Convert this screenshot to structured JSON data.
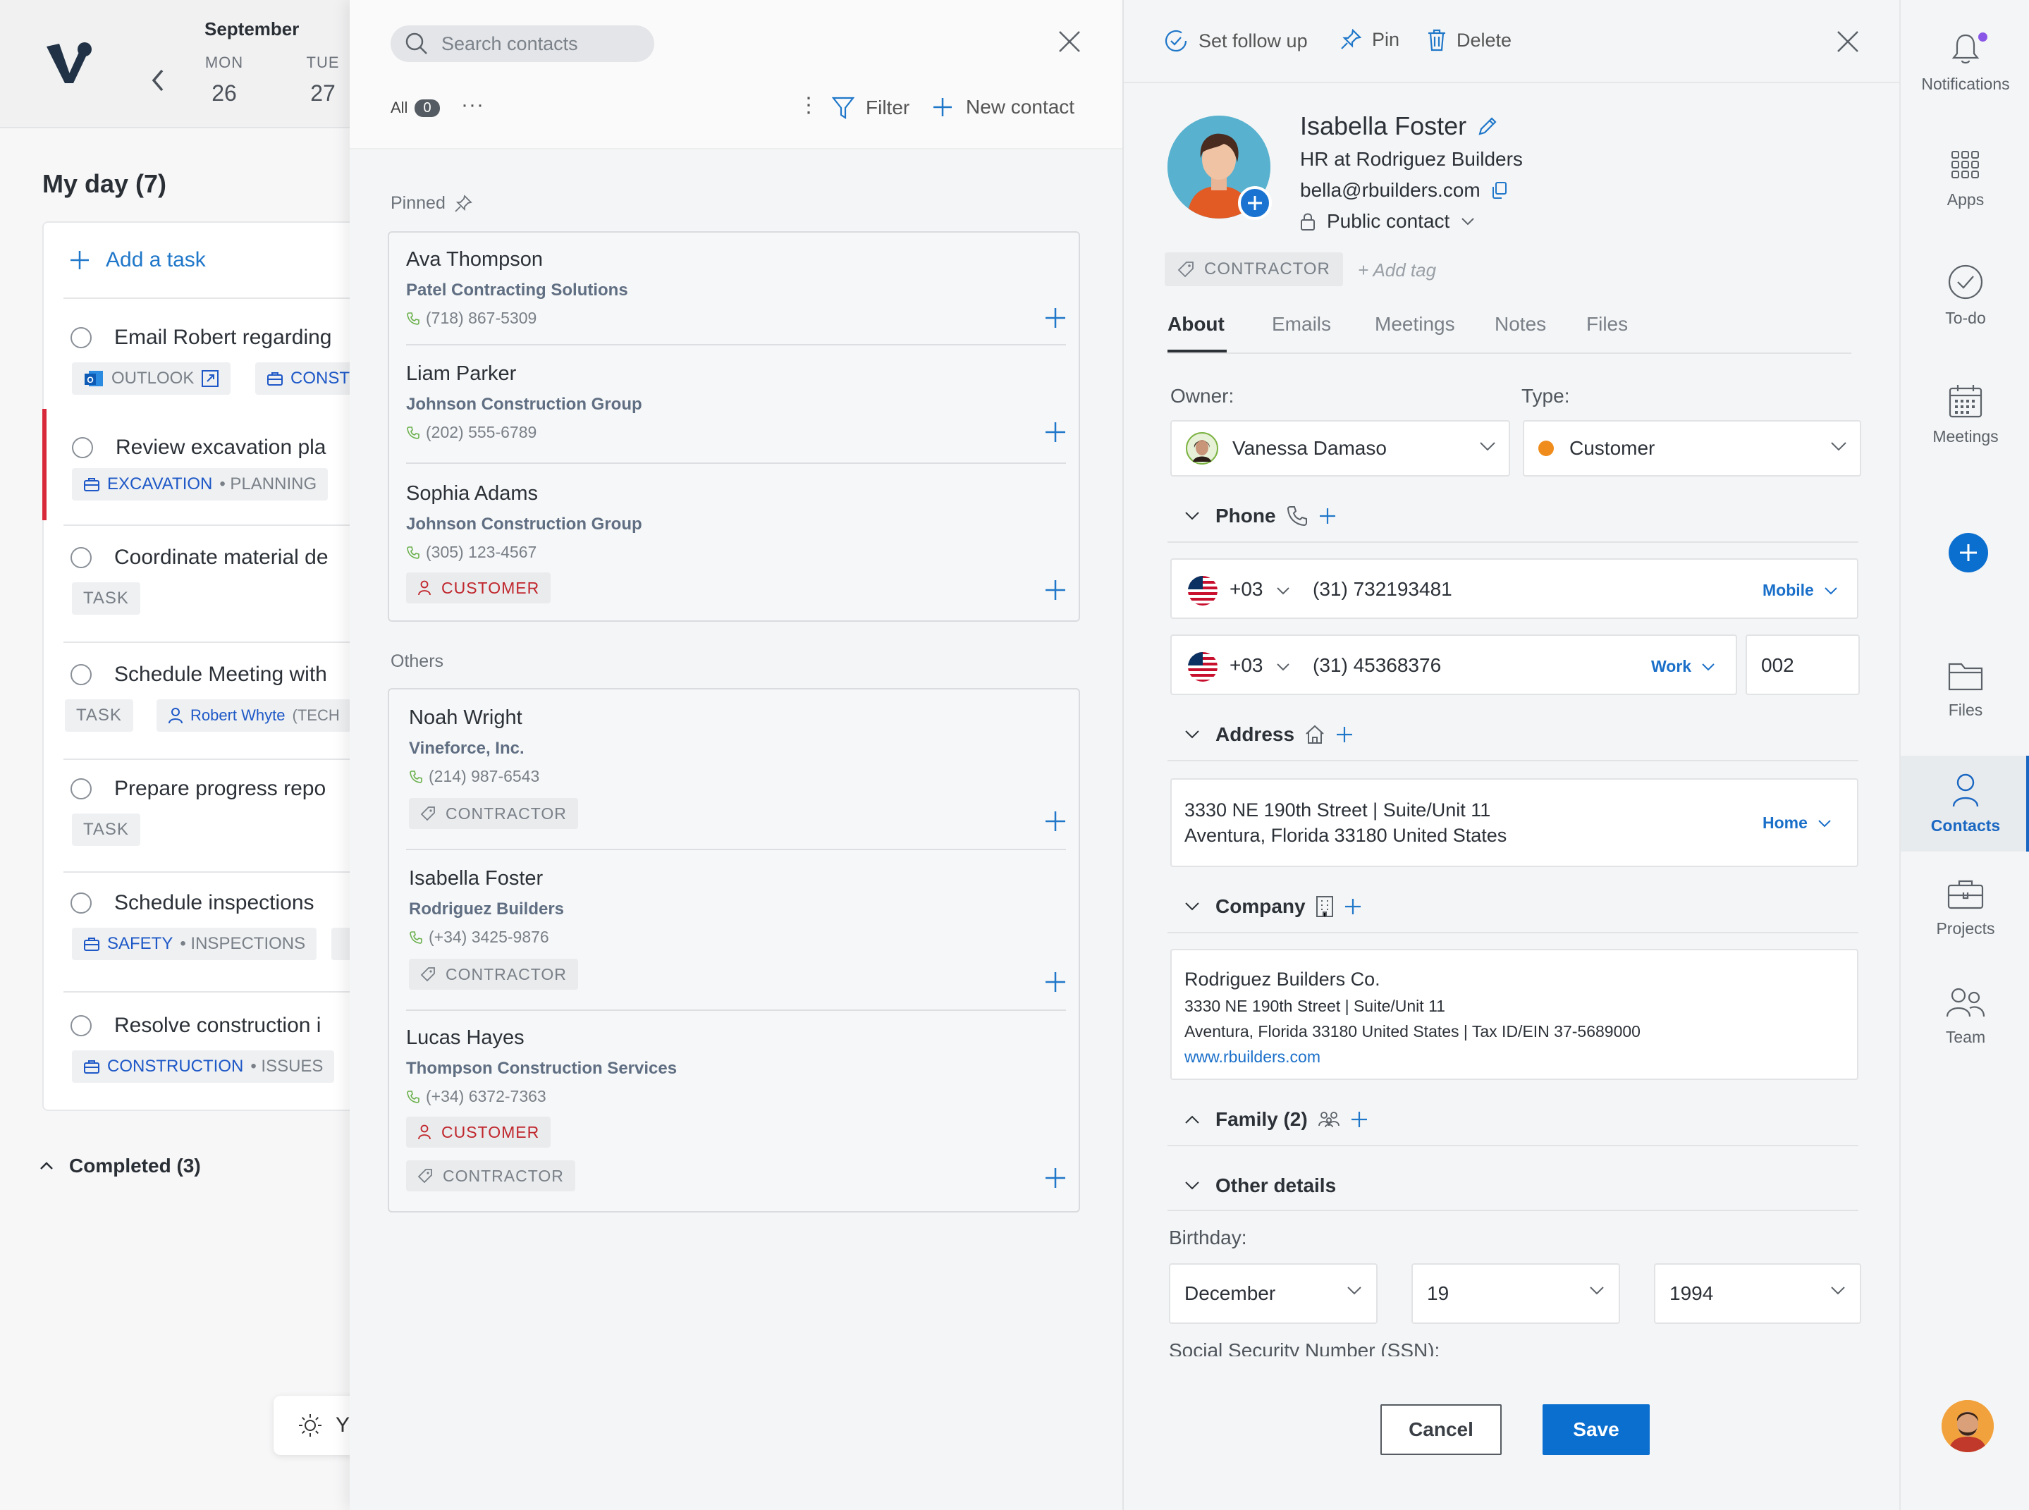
{
  "calendar": {
    "month": "September",
    "days": [
      {
        "name": "MON",
        "num": "26"
      },
      {
        "name": "TUE",
        "num": "27"
      }
    ]
  },
  "myday": {
    "title": "My day (7)",
    "add_task_label": "Add a task",
    "tasks": [
      {
        "title": "Email Robert regarding",
        "chip1_label": "OUTLOOK",
        "chip2_label": "CONST"
      },
      {
        "title": "Review excavation pla",
        "chip_main": "EXCAVATION",
        "chip_sub": "• PLANNING"
      },
      {
        "title": "Coordinate material de",
        "chip_label": "TASK"
      },
      {
        "title": "Schedule Meeting with",
        "chip_label": "TASK",
        "person_name": "Robert Whyte",
        "person_suffix": "(TECH"
      },
      {
        "title": "Prepare progress repo",
        "chip_label": "TASK"
      },
      {
        "title": "Schedule inspections",
        "chip_main": "SAFETY",
        "chip_sub": "• INSPECTIONS"
      },
      {
        "title": "Resolve construction i",
        "chip_main": "CONSTRUCTION",
        "chip_sub": "• ISSUES"
      }
    ],
    "completed_label": "Completed (3)",
    "theme_label": "Y"
  },
  "contacts": {
    "search_placeholder": "Search contacts",
    "all_label": "All",
    "all_count": "0",
    "more_label": "···",
    "kebab_label": "⋮",
    "filter_label": "Filter",
    "new_contact_label": "New contact",
    "pinned_label": "Pinned",
    "others_label": "Others",
    "pinned": [
      {
        "name": "Ava Thompson",
        "company": "Patel Contracting Solutions",
        "phone": "(718) 867-5309"
      },
      {
        "name": "Liam Parker",
        "company": "Johnson Construction Group",
        "phone": "(202) 555-6789"
      },
      {
        "name": "Sophia Adams",
        "company": "Johnson Construction Group",
        "phone": "(305) 123-4567",
        "tag": "CUSTOMER"
      }
    ],
    "others": [
      {
        "name": "Noah Wright",
        "company": "Vineforce, Inc.",
        "phone": "(214) 987-6543",
        "tag": "CONTRACTOR"
      },
      {
        "name": "Isabella Foster",
        "company": "Rodriguez Builders",
        "phone": "(+34) 3425-9876",
        "tag": "CONTRACTOR"
      },
      {
        "name": "Lucas Hayes",
        "company": "Thompson Construction Services",
        "phone": "(+34) 6372-7363",
        "tag1": "CUSTOMER",
        "tag2": "CONTRACTOR"
      }
    ]
  },
  "detail": {
    "actions": {
      "follow_up": "Set follow up",
      "pin": "Pin",
      "delete": "Delete"
    },
    "name": "Isabella Foster",
    "role": "HR at Rodriguez Builders",
    "email": "bella@rbuilders.com",
    "visibility": "Public contact",
    "tag": "CONTRACTOR",
    "add_tag": "+ Add tag",
    "tabs": [
      "About",
      "Emails",
      "Meetings",
      "Notes",
      "Files"
    ],
    "owner_label": "Owner:",
    "owner_value": "Vanessa Damaso",
    "type_label": "Type:",
    "type_value": "Customer",
    "type_color": "#f08c1c",
    "phone_section": "Phone",
    "phones": [
      {
        "cc": "+03",
        "number": "(31)  732193481",
        "type": "Mobile"
      },
      {
        "cc": "+03",
        "number": "(31)  45368376",
        "type": "Work",
        "ext": "002"
      }
    ],
    "address_section": "Address",
    "address": {
      "line1": "3330 NE 190th Street | Suite/Unit 11",
      "line2": "Aventura, Florida 33180  United States",
      "type": "Home"
    },
    "company_section": "Company",
    "company": {
      "name": "Rodriguez Builders Co.",
      "line1": "3330 NE 190th Street | Suite/Unit 11",
      "line2": "Aventura, Florida 33180  United States | Tax ID/EIN 37-5689000",
      "website": "www.rbuilders.com"
    },
    "family_section": "Family (2)",
    "other_section": "Other details",
    "birthday_label": "Birthday:",
    "birthday": {
      "month": "December",
      "day": "19",
      "year": "1994"
    },
    "ssn_label": "Social Security Number (SSN):",
    "cancel_label": "Cancel",
    "save_label": "Save"
  },
  "rail": {
    "notifications": "Notifications",
    "apps": "Apps",
    "todo": "To-do",
    "meetings": "Meetings",
    "files": "Files",
    "contacts": "Contacts",
    "projects": "Projects",
    "team": "Team"
  },
  "colors": {
    "accent": "#0b6fd0",
    "customer_red": "#c0272d",
    "urgent": "#d8293b"
  }
}
